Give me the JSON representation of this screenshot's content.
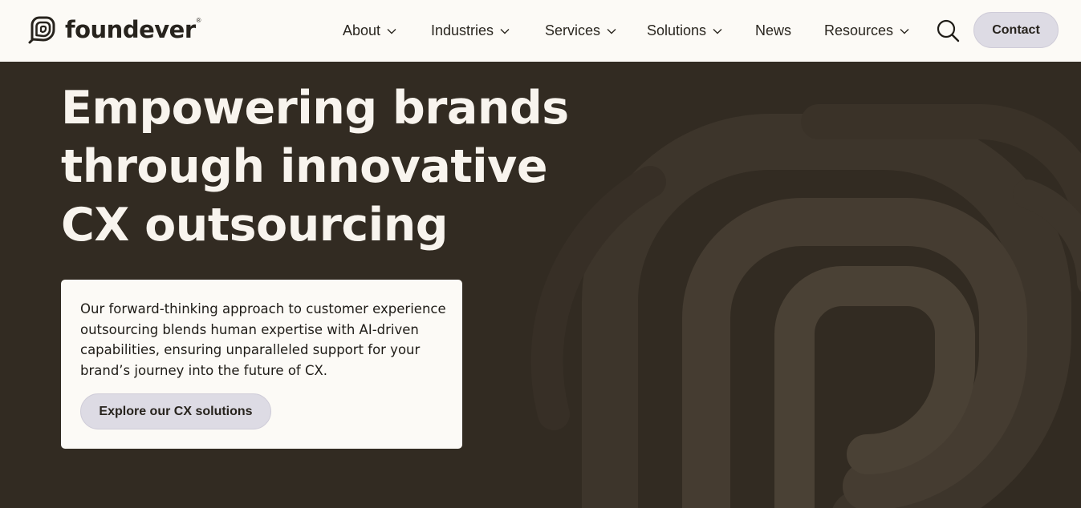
{
  "brand": {
    "name": "foundever",
    "registered_mark": "®",
    "logo_icon": "foundever-logo-icon"
  },
  "nav": {
    "items": [
      {
        "label": "About",
        "has_dropdown": true
      },
      {
        "label": "Industries",
        "has_dropdown": true
      },
      {
        "label": "Services",
        "has_dropdown": true
      },
      {
        "label": "Solutions",
        "has_dropdown": true
      },
      {
        "label": "News",
        "has_dropdown": false
      },
      {
        "label": "Resources",
        "has_dropdown": true
      }
    ],
    "search_icon": "search-icon",
    "contact_label": "Contact"
  },
  "hero": {
    "headline_lines": [
      "Empowering brands",
      "through innovative",
      "CX outsourcing"
    ],
    "description": "Our forward-thinking approach to customer experience outsourcing blends human expertise with AI-driven capabilities, ensuring unparalleled support for your brand’s journey into the future of CX.",
    "cta_label": "Explore our CX solutions"
  },
  "colors": {
    "nav_background": "#fcfaf6",
    "hero_background": "#322b22",
    "headline_text": "#f8f4ee",
    "button_background": "#dddbe4",
    "text_dark": "#27231d"
  }
}
